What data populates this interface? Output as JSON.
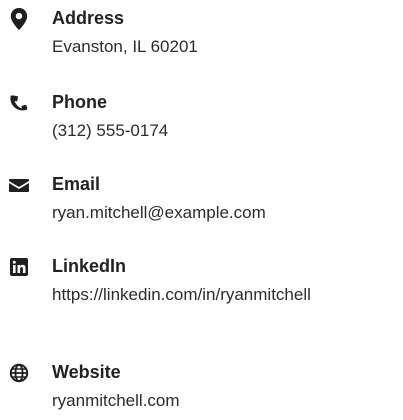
{
  "contacts": {
    "address": {
      "label": "Address",
      "value": "Evanston, IL 60201",
      "icon": "map-pin-icon"
    },
    "phone": {
      "label": "Phone",
      "value": "(312) 555-0174",
      "icon": "phone-icon"
    },
    "email": {
      "label": "Email",
      "value": "ryan.mitchell@example.com",
      "icon": "envelope-icon"
    },
    "linkedin": {
      "label": "LinkedIn",
      "value": "https://linkedin.com/in/ryanmitchell",
      "icon": "linkedin-icon"
    },
    "website": {
      "label": "Website",
      "value": "ryanmitchell.com",
      "icon": "globe-icon"
    }
  },
  "colors": {
    "text": "#222222",
    "icon": "#1f1f1f"
  }
}
